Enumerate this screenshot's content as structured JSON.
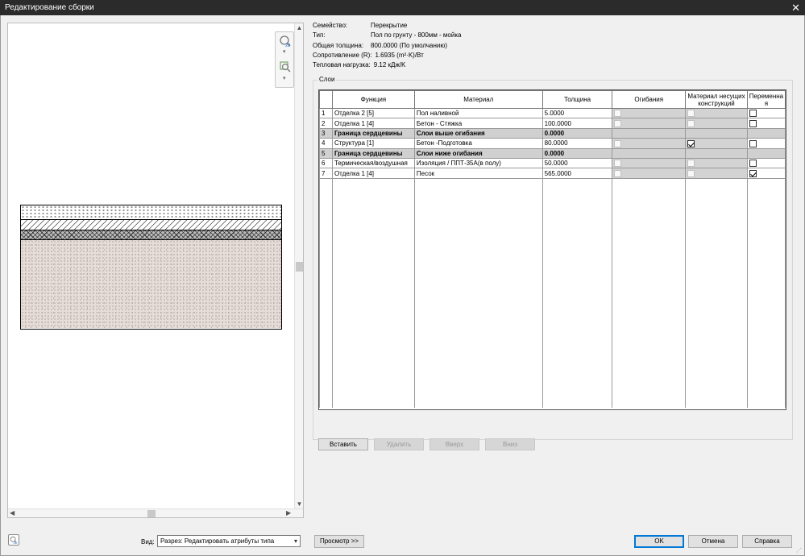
{
  "window": {
    "title": "Редактирование сборки",
    "close_glyph": "✕"
  },
  "info": {
    "family_label": "Семейство:",
    "family_value": "Перекрытие",
    "type_label": "Тип:",
    "type_value": "Пол по грунту - 800мм - мойка",
    "thickness_label": "Общая толщина:",
    "thickness_value": "800.0000 (По умолчанию)",
    "resistance_label": "Сопротивление (R):",
    "resistance_value": "1.6935 (m²·K)/Вт",
    "thermal_label": "Тепловая нагрузка:",
    "thermal_value": "9.12 кДж/K"
  },
  "layers": {
    "group_label": "Слои",
    "columns": [
      "",
      "Функция",
      "Материал",
      "Толщина",
      "Огибания",
      "Материал несущих конструкций",
      "Переменна я"
    ],
    "rows": [
      {
        "n": "1",
        "func": "Отделка 2 [5]",
        "mat": "Пол наливной",
        "thick": "5.0000",
        "core": false,
        "wrap": "off",
        "struct": "off",
        "var": "empty"
      },
      {
        "n": "2",
        "func": "Отделка 1 [4]",
        "mat": "Бетон - Стяжка",
        "thick": "100.0000",
        "core": false,
        "wrap": "off",
        "struct": "off",
        "var": "empty"
      },
      {
        "n": "3",
        "func": "Граница сердцевины",
        "mat": "Слои выше огибания",
        "thick": "0.0000",
        "core": true
      },
      {
        "n": "4",
        "func": "Структура [1]",
        "mat": "Бетон -Подготовка",
        "thick": "80.0000",
        "core": false,
        "wrap": "off",
        "struct": "on",
        "var": "empty"
      },
      {
        "n": "5",
        "func": "Граница сердцевины",
        "mat": "Слои ниже огибания",
        "thick": "0.0000",
        "core": true
      },
      {
        "n": "6",
        "func": "Термическая/воздушная",
        "mat": "Изоляция / ППТ-35А(в полу)",
        "thick": "50.0000",
        "core": false,
        "wrap": "off",
        "struct": "off",
        "var": "empty"
      },
      {
        "n": "7",
        "func": "Отделка 1 [4]",
        "mat": "Песок",
        "thick": "565.0000",
        "core": false,
        "wrap": "off",
        "struct": "off",
        "var": "on"
      }
    ],
    "buttons": {
      "insert": "Вставить",
      "delete": "Удалить",
      "up": "Вверх",
      "down": "Вниз"
    }
  },
  "bottom": {
    "view_label": "Вид:",
    "view_value": "Разрез: Редактировать атрибуты типа",
    "preview_button": "Просмотр >>",
    "ok": "OK",
    "cancel": "Отмена",
    "help": "Справка"
  },
  "icons": {
    "zoom": "zoom-2d-icon",
    "fit": "zoom-fit-icon",
    "bottom": "view-2d-icon",
    "scroll_up": "▲",
    "scroll_down": "▼",
    "scroll_left": "◀",
    "scroll_right": "▶",
    "dropdown": "▾"
  }
}
